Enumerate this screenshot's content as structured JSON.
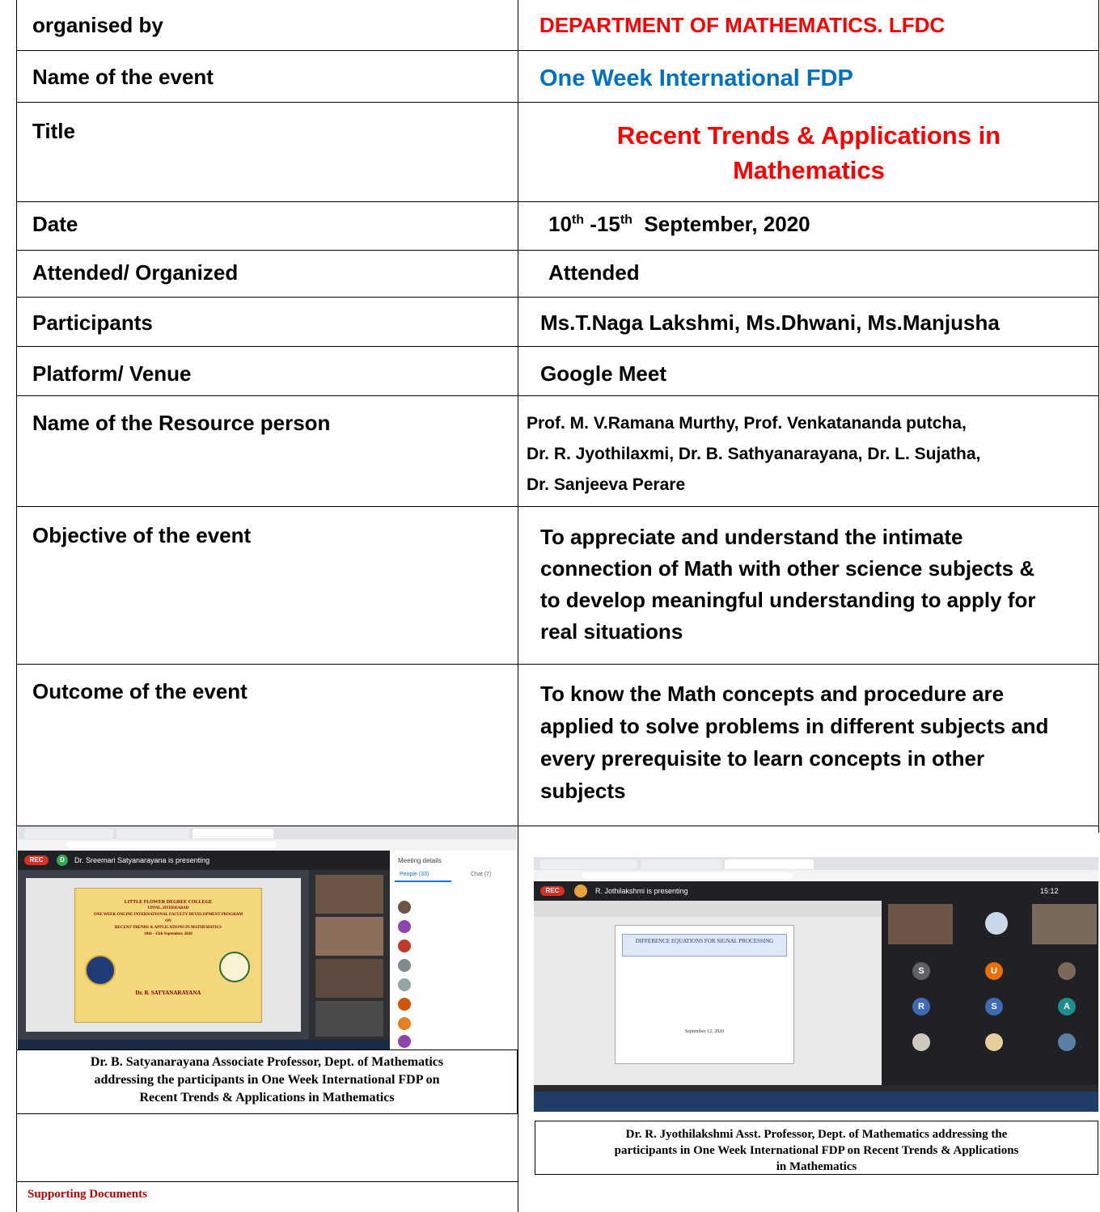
{
  "table": {
    "rows": [
      {
        "label": "organised by",
        "value": "DEPARTMENT OF MATHEMATICS. LFDC"
      },
      {
        "label": "Name of the event",
        "value": "One Week International FDP"
      },
      {
        "label": "Title",
        "value_line1": "Recent Trends & Applications in",
        "value_line2": "Mathematics"
      },
      {
        "label": "Date",
        "value_a": "10",
        "sup_a": "th",
        "value_b": " -15",
        "sup_b": "th",
        "value_c": "  September, 2020"
      },
      {
        "label": "Attended/ Organized",
        "value": "Attended"
      },
      {
        "label": "Participants",
        "value": "Ms.T.Naga Lakshmi, Ms.Dhwani, Ms.Manjusha"
      },
      {
        "label": "Platform/ Venue",
        "value": "Google Meet"
      },
      {
        "label": "Name of the Resource person",
        "value_lines": [
          "Prof. M. V.Ramana Murthy, Prof. Venkatananda putcha,",
          "Dr. R. Jyothilaxmi, Dr. B. Sathyanarayana, Dr. L. Sujatha,",
          "Dr. Sanjeeva Perare"
        ]
      },
      {
        "label": "Objective of the event",
        "value_lines": [
          "To appreciate and understand the intimate",
          "connection of Math with other science subjects &",
          "to develop meaningful understanding to apply for",
          "real situations"
        ]
      },
      {
        "label": "Outcome of the event",
        "value_lines": [
          "To know the Math concepts and procedure are",
          "applied to solve problems in different subjects and",
          "every prerequisite to learn concepts in other",
          "subjects"
        ]
      }
    ]
  },
  "photos": {
    "left": {
      "rec": "REC",
      "presenting": "Dr. Sreemari Satyanarayana is presenting",
      "panel_title": "Meeting details",
      "people_tab": "People (33)",
      "chat_tab": "Chat (7)",
      "slide_lines": [
        "LITTLE FLOWER DEGREE COLLEGE",
        "UPPAL, HYDERABAD",
        "ONE WEEK ONLINE INTERNATIONAL FACULTY DEVELOPMENT PROGRAM",
        "ON",
        "RECENT TRENDS & APPLICATIONS IN MATHEMATICS",
        "10th - 15th September, 2020"
      ],
      "slide_speaker": "Dr. B. SATYANARAYANA",
      "caption_lines": [
        "Dr. B. Satyanarayana Associate Professor, Dept. of Mathematics",
        "addressing the participants in One Week International FDP on",
        "Recent Trends & Applications in Mathematics"
      ]
    },
    "right": {
      "rec": "REC",
      "presenting": "R. Jothilakshmi is presenting",
      "clock": "15:12",
      "slide_title": "DIFFERENCE EQUATIONS FOR SIGNAL PROCESSING",
      "slide_date": "September 12, 2020",
      "tiles": [
        "S",
        "U",
        "R",
        "S",
        "A"
      ],
      "caption_lines": [
        "Dr. R. Jyothilakshmi Asst. Professor, Dept. of Mathematics addressing the",
        "participants in One Week International FDP on Recent Trends & Applications",
        "in Mathematics"
      ]
    }
  },
  "supporting_documents": "Supporting Documents",
  "colors": {
    "red": "#ff0000",
    "blue": "#0070c0",
    "caption_red": "#c00000"
  }
}
